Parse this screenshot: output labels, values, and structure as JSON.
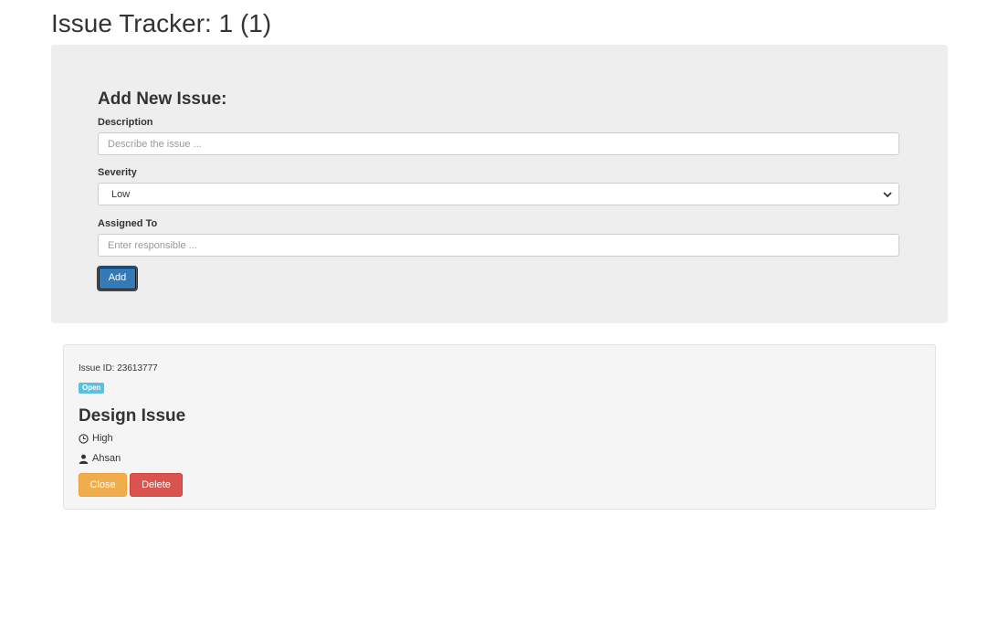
{
  "header": {
    "title": "Issue Tracker: 1 (1)"
  },
  "form": {
    "heading": "Add New Issue:",
    "description": {
      "label": "Description",
      "placeholder": "Describe the issue ...",
      "value": ""
    },
    "severity": {
      "label": "Severity",
      "selected": "Low"
    },
    "assigned_to": {
      "label": "Assigned To",
      "placeholder": "Enter responsible ...",
      "value": ""
    },
    "add_label": "Add"
  },
  "issues": [
    {
      "id_text": "Issue ID: 23613777",
      "status": "Open",
      "title": "Design Issue",
      "severity": "High",
      "assignee": "Ahsan",
      "close_label": "Close",
      "delete_label": "Delete",
      "icons": {
        "severity": "clock-icon",
        "assignee": "user-icon"
      }
    }
  ],
  "colors": {
    "primary": "#337ab7",
    "info": "#5bc0de",
    "warning": "#f0ad4e",
    "danger": "#d9534f",
    "jumbotron_bg": "#eeeeee"
  }
}
